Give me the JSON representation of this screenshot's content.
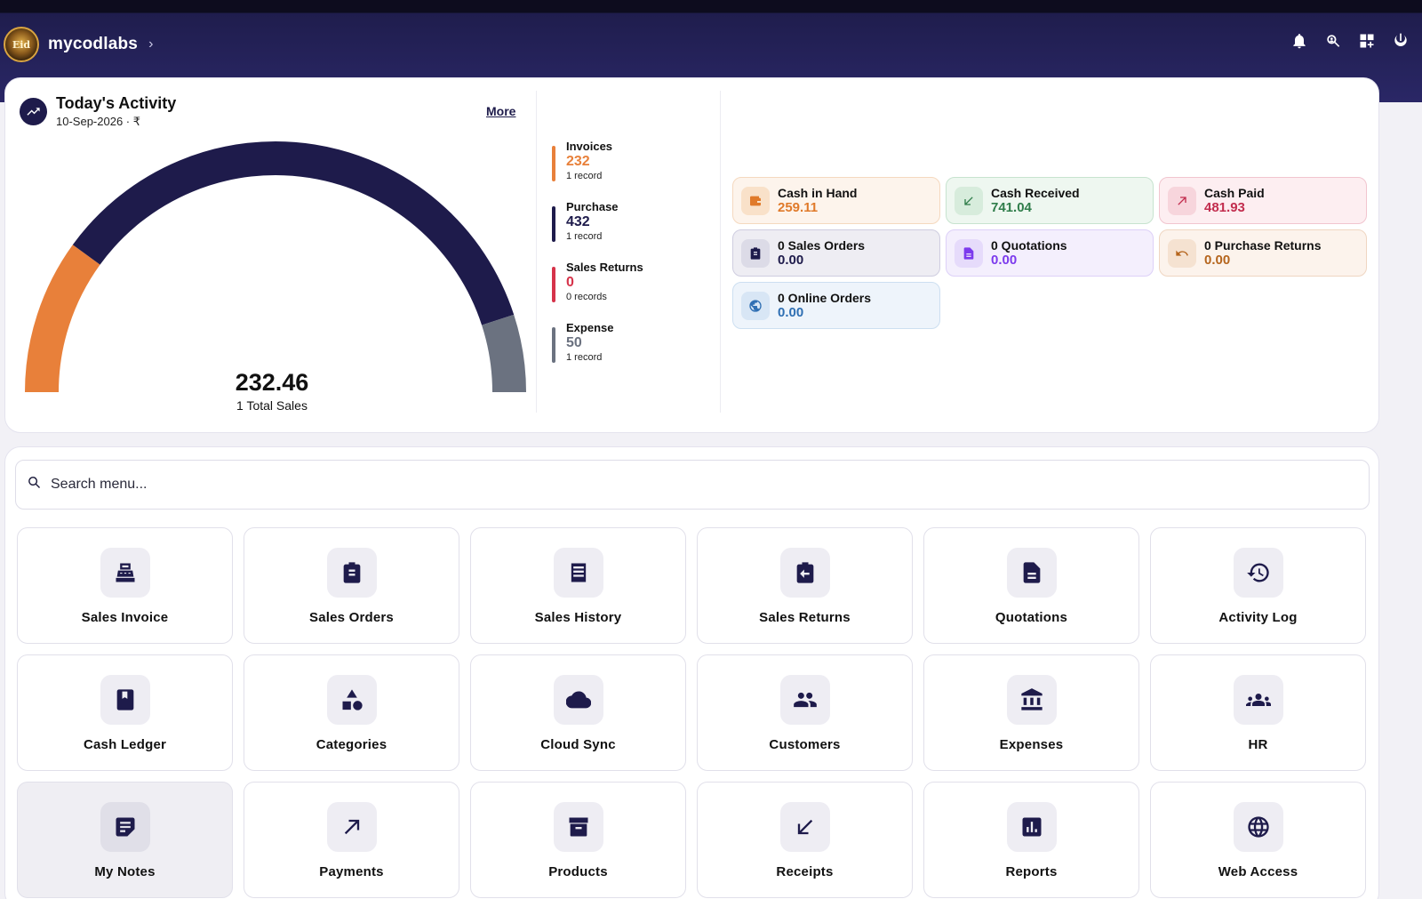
{
  "app": {
    "name": "mycodlabs",
    "logo_text": "Eid"
  },
  "header_icons": [
    "bell-icon",
    "search-user-icon",
    "grid-add-icon",
    "power-icon"
  ],
  "activity": {
    "title": "Today's Activity",
    "date": "10-Sep-2026 · ₹",
    "more": "More",
    "total_value": "232.46",
    "total_label": "1 Total Sales",
    "gauge_share": {
      "orange": 0.2,
      "navy": 0.7,
      "gray": 0.1
    },
    "stats": [
      {
        "name": "Invoices",
        "value": "232",
        "sub": "1 record",
        "color": "#e8803a"
      },
      {
        "name": "Purchase",
        "value": "432",
        "sub": "1 record",
        "color": "#1e1b4b"
      },
      {
        "name": "Sales Returns",
        "value": "0",
        "sub": "0 records",
        "color": "#d6334a"
      },
      {
        "name": "Expense",
        "value": "50",
        "sub": "1 record",
        "color": "#6b7280"
      }
    ],
    "tiles": [
      {
        "label": "Cash in Hand",
        "value": "259.11",
        "icon": "wallet-icon",
        "color": "#e07a2a",
        "bg": "#fdf4ec",
        "border": "#f5d9bf",
        "icbg": "#f9e1c9"
      },
      {
        "label": "Cash Received",
        "value": "741.04",
        "icon": "arrow-down-left-icon",
        "color": "#2f7d4a",
        "bg": "#eef7f0",
        "border": "#c7e3cf",
        "icbg": "#d7ecdc"
      },
      {
        "label": "Cash Paid",
        "value": "481.93",
        "icon": "arrow-up-right-icon",
        "color": "#c22d4e",
        "bg": "#fdeef1",
        "border": "#f1c5cf",
        "icbg": "#f7d5dc"
      },
      {
        "label": "0 Sales Orders",
        "value": "0.00",
        "icon": "clipboard-icon",
        "color": "#1e1b4b",
        "bg": "#eeedf3",
        "border": "#cfcde0",
        "icbg": "#dcdbe7"
      },
      {
        "label": "0 Quotations",
        "value": "0.00",
        "icon": "document-icon",
        "color": "#7c3aed",
        "bg": "#f4effd",
        "border": "#ddd0f8",
        "icbg": "#e6dbfb"
      },
      {
        "label": "0 Purchase Returns",
        "value": "0.00",
        "icon": "undo-icon",
        "color": "#b5651d",
        "bg": "#fcf3ec",
        "border": "#efd6c2",
        "icbg": "#f5e2d1"
      },
      {
        "label": "0 Online Orders",
        "value": "0.00",
        "icon": "globe-icon",
        "color": "#2f6fb3",
        "bg": "#eef4fb",
        "border": "#cddff1",
        "icbg": "#d8e6f5"
      }
    ]
  },
  "search": {
    "placeholder": "Search menu..."
  },
  "menu": [
    {
      "label": "Sales Invoice",
      "icon": "register-icon"
    },
    {
      "label": "Sales Orders",
      "icon": "clipboard-icon"
    },
    {
      "label": "Sales History",
      "icon": "list-icon"
    },
    {
      "label": "Sales Returns",
      "icon": "return-icon"
    },
    {
      "label": "Quotations",
      "icon": "document-icon"
    },
    {
      "label": "Activity Log",
      "icon": "history-icon"
    },
    {
      "label": "Cash Ledger",
      "icon": "book-icon"
    },
    {
      "label": "Categories",
      "icon": "shapes-icon"
    },
    {
      "label": "Cloud Sync",
      "icon": "cloud-icon"
    },
    {
      "label": "Customers",
      "icon": "people-icon"
    },
    {
      "label": "Expenses",
      "icon": "bank-icon"
    },
    {
      "label": "HR",
      "icon": "groups-icon"
    },
    {
      "label": "My Notes",
      "icon": "notes-icon",
      "active": true
    },
    {
      "label": "Payments",
      "icon": "arrow-up-right-icon"
    },
    {
      "label": "Products",
      "icon": "archive-icon"
    },
    {
      "label": "Receipts",
      "icon": "arrow-down-left-icon"
    },
    {
      "label": "Reports",
      "icon": "bar-chart-icon"
    },
    {
      "label": "Web Access",
      "icon": "globe-icon"
    }
  ]
}
